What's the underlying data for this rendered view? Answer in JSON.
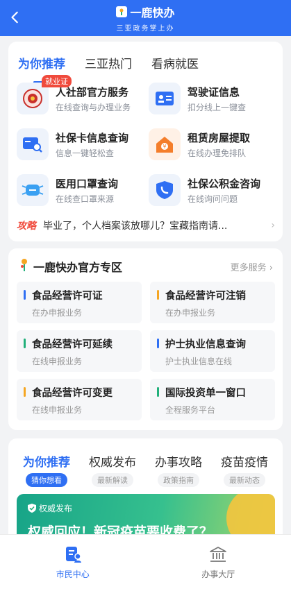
{
  "header": {
    "app_name": "一鹿快办",
    "slogan": "三亚政务掌上办",
    "brand_color": "#2f6ff3"
  },
  "recommend": {
    "tabs": [
      "为你推荐",
      "三亚热门",
      "看病就医"
    ],
    "services": [
      {
        "title": "人社部官方服务",
        "desc": "在线查询与办理业务",
        "icon": "emblem-icon",
        "badge": "就业证"
      },
      {
        "title": "驾驶证信息",
        "desc": "扣分线上一键查",
        "icon": "id-card-icon"
      },
      {
        "title": "社保卡信息查询",
        "desc": "信息一键轻松查",
        "icon": "card-search-icon"
      },
      {
        "title": "租赁房屋提取",
        "desc": "在线办理免排队",
        "icon": "house-money-icon"
      },
      {
        "title": "医用口罩查询",
        "desc": "在线查口罩来源",
        "icon": "mask-icon"
      },
      {
        "title": "社保公积金咨询",
        "desc": "在线询问问题",
        "icon": "shield-phone-icon"
      }
    ],
    "tip_tag": "攻略",
    "tip_text": "毕业了，个人档案该放哪儿？宝藏指南请..."
  },
  "official": {
    "title": "一鹿快办官方专区",
    "more": "更多服务",
    "tiles": [
      {
        "title": "食品经营许可证",
        "desc": "在办申报业务",
        "color": "#2f6ff3"
      },
      {
        "title": "食品经营许可注销",
        "desc": "在办申报业务",
        "color": "#f5a623"
      },
      {
        "title": "食品经营许可延续",
        "desc": "在线申报业务",
        "color": "#21b07a"
      },
      {
        "title": "护士执业信息查询",
        "desc": "护士执业信息在线",
        "color": "#2f6ff3"
      },
      {
        "title": "食品经营许可变更",
        "desc": "在线申报业务",
        "color": "#f5a623"
      },
      {
        "title": "国际投资单一窗口",
        "desc": "全程服务平台",
        "color": "#21b07a"
      }
    ]
  },
  "feed": {
    "tabs": [
      {
        "main": "为你推荐",
        "sub": "猜你想看"
      },
      {
        "main": "权威发布",
        "sub": "最新解读"
      },
      {
        "main": "办事攻略",
        "sub": "政策指南"
      },
      {
        "main": "疫苗疫情",
        "sub": "最新动态"
      }
    ],
    "banner_tag": "权威发布",
    "banner_title": "权威回应！新冠疫苗要收费了？"
  },
  "bottom_nav": [
    {
      "label": "市民中心",
      "icon": "citizen-center-icon"
    },
    {
      "label": "办事大厅",
      "icon": "hall-icon"
    }
  ]
}
